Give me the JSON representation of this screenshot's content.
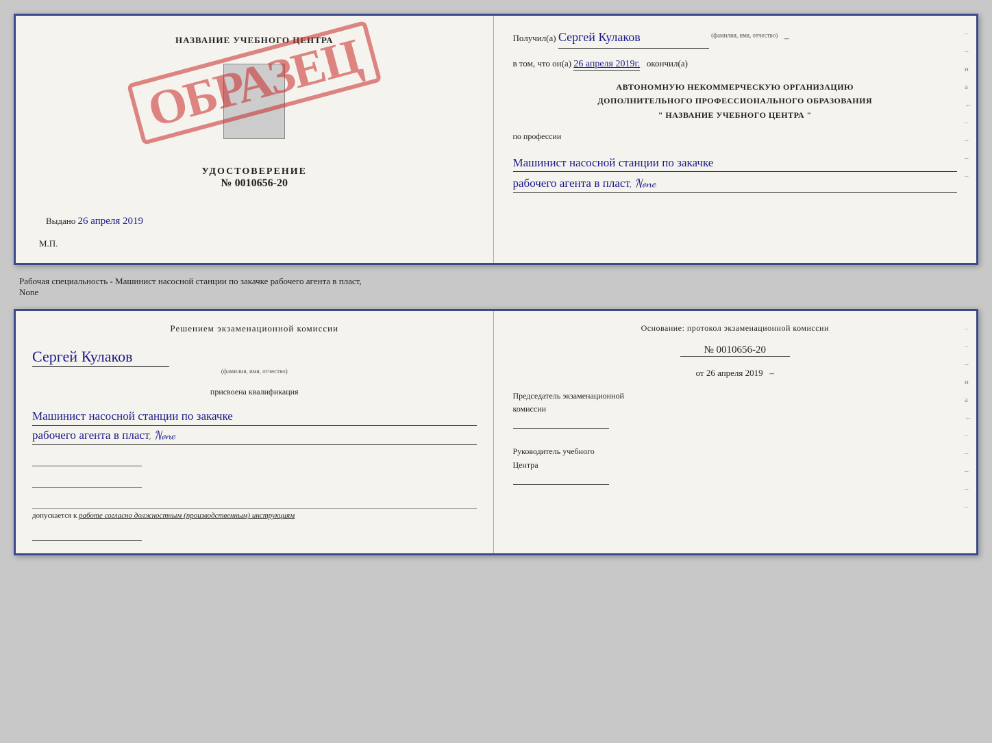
{
  "top_doc": {
    "left": {
      "center_title": "НАЗВАНИЕ УЧЕБНОГО ЦЕНТРА",
      "stamp_text": "ОБРАЗЕЦ",
      "udostoverenie_label": "УДОСТОВЕРЕНИЕ",
      "udostoverenie_num": "№ 0010656-20",
      "vydano_label": "Выдано",
      "vydano_date": "26 апреля 2019",
      "mp_label": "М.П."
    },
    "right": {
      "poluchil_label": "Получил(а)",
      "poluchil_name": "Сергей Кулаков",
      "poluchil_hint": "(фамилия, имя, отчество)",
      "dash1": "–",
      "vtom_label": "в том, что он(а)",
      "vtom_date": "26 апреля 2019г.",
      "okonchil_label": "окончил(а)",
      "org_line1": "АВТОНОМНУЮ НЕКОММЕРЧЕСКУЮ ОРГАНИЗАЦИЮ",
      "org_line2": "ДОПОЛНИТЕЛЬНОГО ПРОФЕССИОНАЛЬНОГО ОБРАЗОВАНИЯ",
      "org_line3": "\"   НАЗВАНИЕ УЧЕБНОГО ЦЕНТРА   \"",
      "po_professii_label": "по профессии",
      "profession_line1": "Машинист насосной станции по закачке",
      "profession_line2": "рабочего агента в пласт, None"
    }
  },
  "between_text": "Рабочая специальность - Машинист насосной станции по закачке рабочего агента в пласт,\nNone",
  "bottom_doc": {
    "left": {
      "resheniem_label": "Решением  экзаменационной  комиссии",
      "person_name": "Сергей Кулаков",
      "fio_hint": "(фамилия, имя, отчество)",
      "prisvoena_label": "присвоена квалификация",
      "qualification_line1": "Машинист насосной станции по закачке",
      "qualification_line2": "рабочего агента в пласт, None",
      "dopuskaetsya_label": "допускается к",
      "dopuskaetsya_text": "работе согласно должностным (производственным) инструкциям"
    },
    "right": {
      "osnovanie_label": "Основание: протокол экзаменационной  комиссии",
      "protocol_num": "№  0010656-20",
      "ot_label": "от",
      "ot_date": "26 апреля 2019",
      "predsedatel_line1": "Председатель экзаменационной",
      "predsedatel_line2": "комиссии",
      "rukovoditel_line1": "Руководитель учебного",
      "rukovoditel_line2": "Центра"
    }
  },
  "dashes": [
    "-",
    "-",
    "-",
    "и",
    "а",
    "←",
    "-",
    "-",
    "-",
    "-",
    "-"
  ],
  "right_dashes2": [
    "-",
    "-",
    "-",
    "и",
    "а",
    "←",
    "-",
    "-",
    "-",
    "-",
    "-",
    "-"
  ]
}
